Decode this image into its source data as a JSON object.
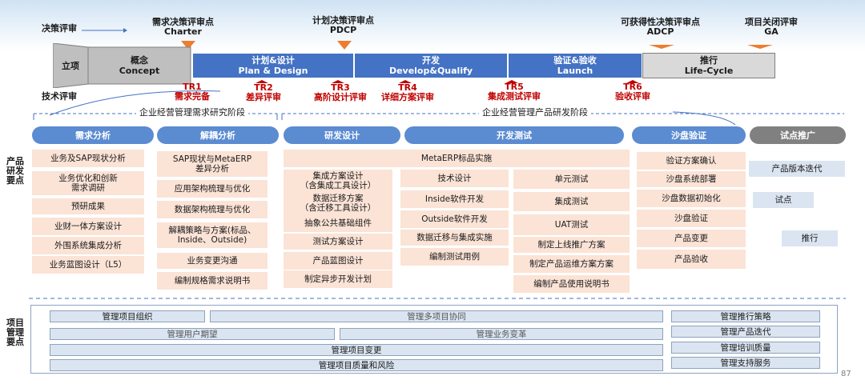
{
  "decision_review": {
    "label": "决策评审"
  },
  "tech_review": {
    "label": "技术评审"
  },
  "decision_points": [
    {
      "cn": "需求决策评审点",
      "en": "Charter"
    },
    {
      "cn": "计划决策评审点",
      "en": "PDCP"
    },
    {
      "cn": "可获得性决策评审点",
      "en": "ADCP"
    },
    {
      "cn": "项目关闭评审",
      "en": "GA"
    }
  ],
  "stages": [
    {
      "cn": "立项",
      "en": ""
    },
    {
      "cn": "概念",
      "en": "Concept"
    },
    {
      "cn": "计划&设计",
      "en": "Plan & Design"
    },
    {
      "cn": "开发",
      "en": "Develop&Qualify"
    },
    {
      "cn": "验证&验收",
      "en": "Launch"
    },
    {
      "cn": "推行",
      "en": "Life-Cycle"
    }
  ],
  "tr_points": [
    {
      "code": "TR1",
      "name": "需求完备"
    },
    {
      "code": "TR2",
      "name": "差异评审"
    },
    {
      "code": "TR3",
      "name": "高阶设计评审"
    },
    {
      "code": "TR4",
      "name": "详细方案评审"
    },
    {
      "code": "TR5",
      "name": "集成测试评审"
    },
    {
      "code": "TR6",
      "name": "验收评审"
    }
  ],
  "stage_groups": [
    "企业经营管理需求研究阶段",
    "企业经营管理产品研发阶段"
  ],
  "phases": [
    "需求分析",
    "解耦分析",
    "研发设计",
    "开发测试",
    "沙盘验证",
    "试点推广"
  ],
  "product_side_label": "产品\n研发\n要点",
  "project_side_label": "项目\n管理\n要点",
  "req_analysis": [
    "业务及SAP现状分析",
    "业务优化和创新\n需求调研",
    "预研成果",
    "业财一体方案设计",
    "外围系统集成分析",
    "业务蓝图设计（L5）"
  ],
  "decouple_analysis": [
    "SAP现状与MetaERP\n差异分析",
    "应用架构梳理与优化",
    "数据架构梳理与优化",
    "解耦策略与方案(标品、\nInside、Outside)",
    "业务变更沟通",
    "编制规格需求说明书"
  ],
  "metaerp_label": "MetaERP标品实施",
  "rd_design": [
    "集成方案设计\n（含集成工具设计）",
    "数据迁移方案\n（含迁移工具设计）",
    "抽象公共基础组件",
    "测试方案设计",
    "产品蓝图设计",
    "制定异步开发计划"
  ],
  "dev_col": [
    "技术设计",
    "Inside软件开发",
    "Outside软件开发",
    "数据迁移与集成实施",
    "编制测试用例"
  ],
  "test_col": [
    "单元测试",
    "集成测试",
    "UAT测试",
    "制定上线推广方案",
    "制定产品运维方案方案",
    "编制产品使用说明书"
  ],
  "sandbox": [
    "验证方案确认",
    "沙盘系统部署",
    "沙盘数据初始化",
    "沙盘验证",
    "产品变更",
    "产品验收"
  ],
  "pilot": [
    "产品版本迭代",
    "试点",
    "推行"
  ],
  "mgmt": {
    "org": "管理项目组织",
    "multi": "管理多项目协同",
    "expect": "管理用户期望",
    "biz_change": "管理业务变革",
    "proj_change": "管理项目变更",
    "quality_risk": "管理项目质量和风险",
    "right": [
      "管理推行策略",
      "管理产品迭代",
      "管理培训质量",
      "管理支持服务"
    ]
  },
  "page_number": "87",
  "colors": {
    "bar_blue": "#4472c4",
    "phase_blue": "#5b8bd1",
    "phase_gray": "#808080",
    "pink": "#fbe3d6",
    "light_blue": "#dbe5f1",
    "review_red": "#c00000",
    "triangle_orange": "#ed7d31"
  }
}
